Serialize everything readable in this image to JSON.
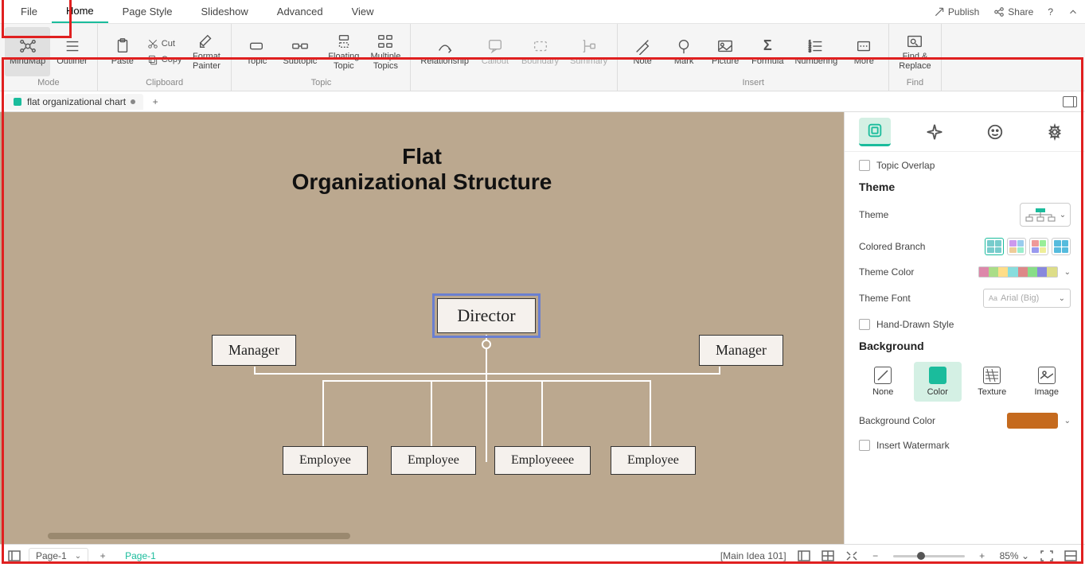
{
  "menu": {
    "items": [
      "File",
      "Home",
      "Page Style",
      "Slideshow",
      "Advanced",
      "View"
    ],
    "active": 1,
    "publish": "Publish",
    "share": "Share"
  },
  "ribbon": {
    "mode": {
      "mindmap": "MindMap",
      "outliner": "Outliner",
      "label": "Mode"
    },
    "clipboard": {
      "paste": "Paste",
      "cut": "Cut",
      "copy": "Copy",
      "fp": "Format\nPainter",
      "label": "Clipboard"
    },
    "topic": {
      "topic": "Topic",
      "subtopic": "Subtopic",
      "floating": "Floating\nTopic",
      "multiple": "Multiple\nTopics",
      "relationship": "Relationship",
      "callout": "Callout",
      "boundary": "Boundary",
      "summary": "Summary",
      "label": "Topic"
    },
    "insert": {
      "note": "Note",
      "mark": "Mark",
      "picture": "Picture",
      "formula": "Formula",
      "numbering": "Numbering",
      "more": "More",
      "label": "Insert"
    },
    "find": {
      "fr": "Find &\nReplace",
      "label": "Find"
    }
  },
  "tab": {
    "name": "flat organizational chart"
  },
  "chart": {
    "title1": "Flat",
    "title2": "Organizational Structure",
    "director": "Director",
    "manager": "Manager",
    "employee": "Employee",
    "employeeee": "Employeeee"
  },
  "side": {
    "overlap": "Topic Overlap",
    "theme_h": "Theme",
    "theme": "Theme",
    "colored": "Colored Branch",
    "tcolor": "Theme Color",
    "tfont": "Theme Font",
    "tfont_val": "Arial (Big)",
    "hand": "Hand-Drawn Style",
    "bg_h": "Background",
    "none": "None",
    "color": "Color",
    "texture": "Texture",
    "image": "Image",
    "bgcolor": "Background Color",
    "watermark": "Insert Watermark"
  },
  "status": {
    "page": "Page-1",
    "pagetab": "Page-1",
    "idea": "[Main Idea 101]",
    "zoom": "85%"
  }
}
